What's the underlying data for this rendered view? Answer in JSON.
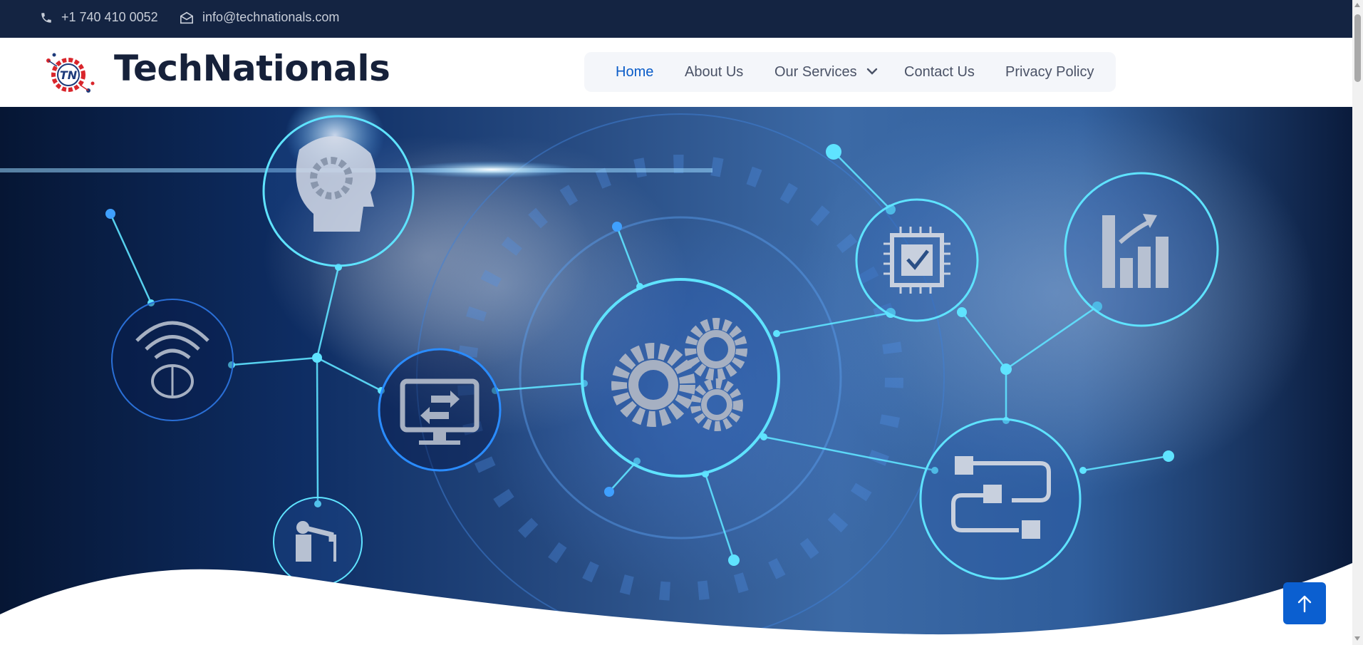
{
  "topbar": {
    "phone": "+1 740 410 0052",
    "email": "info@technationals.com",
    "phone_icon": "phone-icon",
    "email_icon": "envelope-icon"
  },
  "header": {
    "brand": "TechNationals",
    "logo": "technationals-logo"
  },
  "nav": {
    "items": [
      {
        "label": "Home",
        "active": true
      },
      {
        "label": "About Us"
      },
      {
        "label": "Our Services",
        "has_dropdown": true
      },
      {
        "label": "Contact Us"
      },
      {
        "label": "Privacy Policy"
      }
    ]
  },
  "hero": {
    "icons": [
      "ai-head-gear-icon",
      "wifi-brain-icon",
      "monitor-transfer-icon",
      "gears-icon",
      "chip-check-icon",
      "bar-chart-growth-icon",
      "workflow-icon",
      "robot-arm-icon"
    ]
  },
  "scroll_to_top": {
    "icon": "arrow-up-icon"
  },
  "colors": {
    "topbar_bg": "#142442",
    "brand_text": "#16213a",
    "nav_active": "#0a5cc8",
    "nav_bg": "#f4f6fa",
    "accent": "#0b5fd0",
    "hero_glow": "#5fe3ff"
  }
}
